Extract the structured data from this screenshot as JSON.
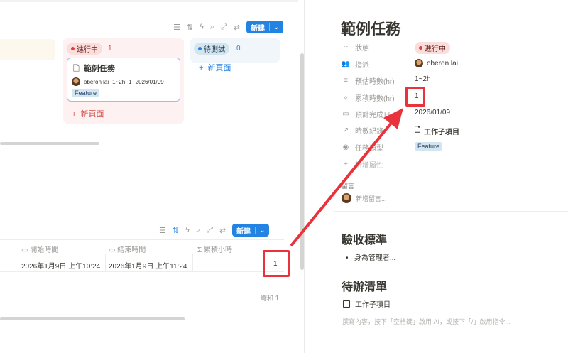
{
  "board": {
    "toolbar": {
      "icons": [
        "filter-icon",
        "sort-icon",
        "lightning-icon",
        "search-icon",
        "expand-icon",
        "settings-icon"
      ],
      "new_label": "新建"
    },
    "columns": [
      {
        "label": "進行中",
        "count": "1",
        "color": "#e03e3e",
        "add_label": "新頁面"
      },
      {
        "label": "待測試",
        "count": "0",
        "color": "#2383e2",
        "add_label": "新頁面"
      }
    ],
    "card": {
      "title": "範例任務",
      "assignee": "oberon lai",
      "estimate": "1~2h",
      "accumulated": "1",
      "date": "2026/01/09",
      "tag": "Feature"
    }
  },
  "table": {
    "toolbar": {
      "new_label": "新建"
    },
    "headers": [
      "開始時間",
      "結束時間",
      "累積小時"
    ],
    "row": {
      "start": "2026年1月9日 上午10:24",
      "end": "2026年1月9日 上午11:24",
      "hours": "1"
    },
    "footer": {
      "label": "總和",
      "value": "1"
    }
  },
  "page": {
    "title": "範例任務",
    "properties": [
      {
        "label": "狀態",
        "value": "進行中"
      },
      {
        "label": "指派",
        "value": "oberon lai"
      },
      {
        "label": "預估時數(hr)",
        "value": "1~2h"
      },
      {
        "label": "累積時數(hr)",
        "value": "1"
      },
      {
        "label": "預計完成日",
        "value": "2026/01/09"
      },
      {
        "label": "時數紀錄",
        "value": "工作子項目"
      },
      {
        "label": "任務類型",
        "value": "Feature"
      }
    ],
    "add_property": "新增屬性",
    "comments_label": "留言",
    "comment_placeholder": "新增留言...",
    "section1": {
      "title": "驗收標準",
      "bullet": "身為管理者..."
    },
    "section2": {
      "title": "待辦清單",
      "todo": "工作子項目"
    },
    "placeholder": "撰寫內容，按下「空格鍵」啟用 AI，或按下「/」啟用指令..."
  },
  "annotation_color": "#e8323c"
}
